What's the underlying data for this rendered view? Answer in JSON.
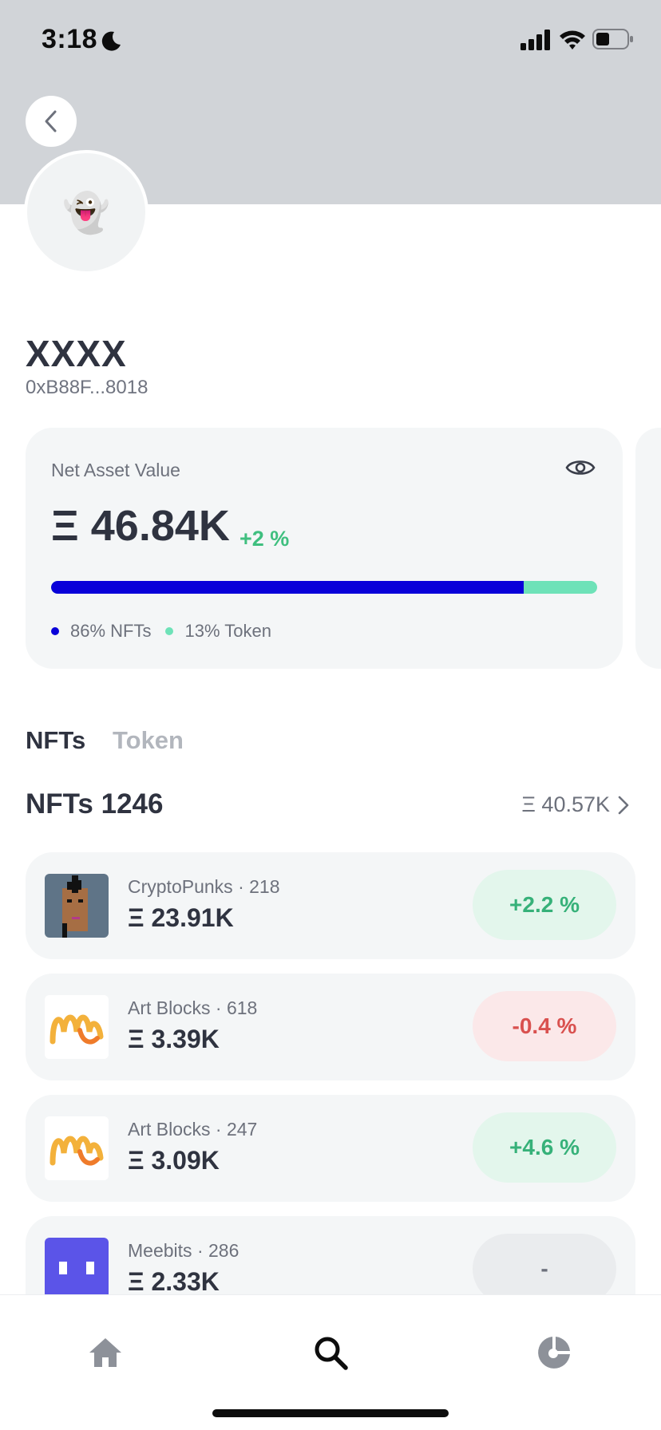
{
  "status_bar": {
    "time": "3:18"
  },
  "profile": {
    "avatar_emoji": "👻",
    "name": "XXXX",
    "address": "0xB88F...8018"
  },
  "net_asset": {
    "label": "Net Asset Value",
    "value": "Ξ 46.84K",
    "change": "+2 %",
    "nfts_share": 0.865,
    "legend": [
      {
        "label": "86% NFTs",
        "color": "#0900d9"
      },
      {
        "label": "13% Token",
        "color": "#6ee2b8"
      }
    ]
  },
  "tabs": {
    "nfts": "NFTs",
    "token": "Token"
  },
  "nfts": {
    "heading": "NFTs 1246",
    "total": "Ξ 40.57K",
    "items": [
      {
        "name": "CryptoPunks",
        "count": "· 218",
        "value": "Ξ 23.91K",
        "change": "+2.2 %",
        "trend": "pos",
        "thumb": "cryptopunk"
      },
      {
        "name": "Art Blocks",
        "count": "· 618",
        "value": "Ξ 3.39K",
        "change": "-0.4 %",
        "trend": "neg",
        "thumb": "artblocks"
      },
      {
        "name": "Art Blocks",
        "count": "· 247",
        "value": "Ξ 3.09K",
        "change": "+4.6 %",
        "trend": "pos",
        "thumb": "artblocks"
      },
      {
        "name": "Meebits",
        "count": "· 286",
        "value": "Ξ 2.33K",
        "change": "-",
        "trend": "flat",
        "thumb": "meebits"
      }
    ]
  },
  "tab_bar": [
    "home-icon",
    "search-icon",
    "portfolio-icon"
  ]
}
